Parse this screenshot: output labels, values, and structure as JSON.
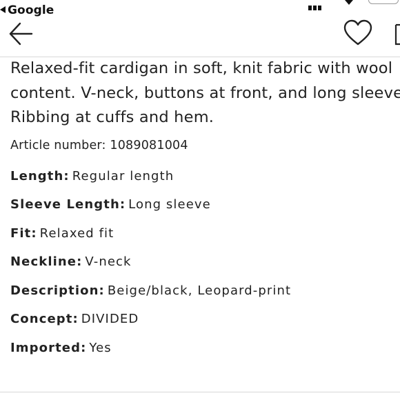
{
  "status_bar": {
    "back_app_label": "Google"
  },
  "nav": {
    "back_icon": "arrow-left-icon",
    "favorite_icon": "heart-icon",
    "bag_icon": "shopping-bag-icon"
  },
  "product": {
    "description_lines": [
      "Relaxed-fit cardigan in soft, knit fabric with wool",
      "content. V-neck, buttons at front, and long sleeves.",
      "Ribbing at cuffs and hem."
    ],
    "article_number": "Article number: 1089081004",
    "specs": [
      {
        "label": "Length:",
        "value": "Regular length"
      },
      {
        "label": "Sleeve Length:",
        "value": "Long sleeve"
      },
      {
        "label": "Fit:",
        "value": "Relaxed fit"
      },
      {
        "label": "Neckline:",
        "value": "V-neck"
      },
      {
        "label": "Description:",
        "value": "Beige/black, Leopard-print"
      },
      {
        "label": "Concept:",
        "value": "DIVIDED"
      },
      {
        "label": "Imported:",
        "value": "Yes"
      }
    ]
  }
}
